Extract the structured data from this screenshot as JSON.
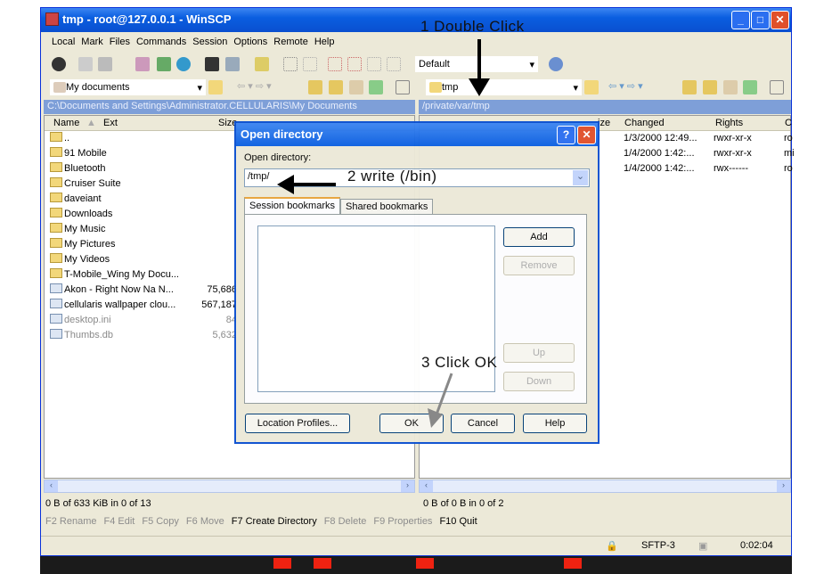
{
  "window": {
    "title": "tmp - root@127.0.0.1 - WinSCP"
  },
  "menu": [
    "Local",
    "Mark",
    "Files",
    "Commands",
    "Session",
    "Options",
    "Remote",
    "Help"
  ],
  "toolbar": {
    "transfer_preset": "Default"
  },
  "left": {
    "location": "My documents",
    "path": "C:\\Documents and Settings\\Administrator.CELLULARIS\\My Documents",
    "columns": [
      "Name",
      "Ext",
      "Size"
    ],
    "files": [
      {
        "name": "..",
        "size": "",
        "type": "up"
      },
      {
        "name": "91 Mobile",
        "size": "",
        "type": "folder"
      },
      {
        "name": "Bluetooth",
        "size": "",
        "type": "folder"
      },
      {
        "name": "Cruiser Suite",
        "size": "",
        "type": "folder"
      },
      {
        "name": "daveiant",
        "size": "",
        "type": "folder"
      },
      {
        "name": "Downloads",
        "size": "",
        "type": "folder"
      },
      {
        "name": "My Music",
        "size": "",
        "type": "folder"
      },
      {
        "name": "My Pictures",
        "size": "",
        "type": "folder"
      },
      {
        "name": "My Videos",
        "size": "",
        "type": "folder"
      },
      {
        "name": "T-Mobile_Wing My Docu...",
        "size": "",
        "type": "folder"
      },
      {
        "name": "Akon - Right Now Na N...",
        "size": "75,686",
        "type": "file"
      },
      {
        "name": "cellularis wallpaper clou...",
        "size": "567,187",
        "type": "file"
      },
      {
        "name": "desktop.ini",
        "size": "84",
        "type": "hidden"
      },
      {
        "name": "Thumbs.db",
        "size": "5,632",
        "type": "hidden"
      }
    ],
    "status": "0 B of 633 KiB in 0 of 13"
  },
  "right": {
    "location": "tmp",
    "path": "/private/var/tmp",
    "columns": [
      "ize",
      "Changed",
      "Rights",
      "C"
    ],
    "files": [
      {
        "changed": "1/3/2000 12:49...",
        "rights": "rwxr-xr-x",
        "owner": "ro"
      },
      {
        "changed": "1/4/2000 1:42:...",
        "rights": "rwxr-xr-x",
        "owner": "mi"
      },
      {
        "changed": "1/4/2000 1:42:...",
        "rights": "rwx------",
        "owner": "ro"
      }
    ],
    "status": "0 B of 0 B in 0 of 2"
  },
  "fkeys": [
    "F2 Rename",
    "F4 Edit",
    "F5 Copy",
    "F6 Move",
    "F7 Create Directory",
    "F8 Delete",
    "F9 Properties",
    "F10 Quit"
  ],
  "statusbar": {
    "protocol": "SFTP-3",
    "elapsed": "0:02:04"
  },
  "dialog": {
    "title": "Open directory",
    "label": "Open directory:",
    "value": "/tmp/",
    "tabs": [
      "Session bookmarks",
      "Shared bookmarks"
    ],
    "side_buttons": [
      "Add",
      "Remove",
      "Up",
      "Down"
    ],
    "buttons": [
      "Location Profiles...",
      "OK",
      "Cancel",
      "Help"
    ]
  },
  "annotations": [
    "1  Double Click",
    "2 write (/bin)",
    "3 Click OK"
  ]
}
